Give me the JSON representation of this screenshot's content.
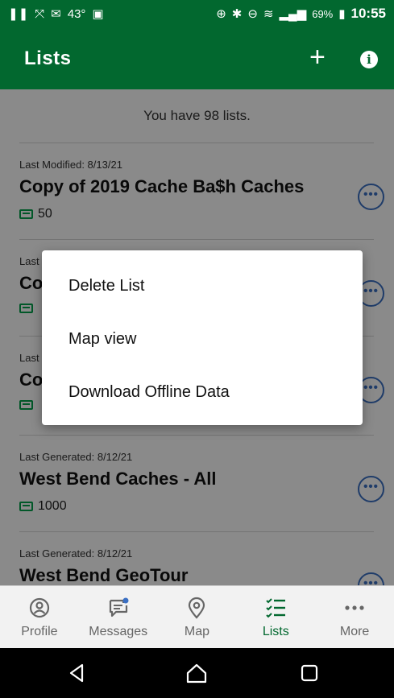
{
  "status_bar": {
    "temperature": "43°",
    "battery": "69%",
    "time": "10:55"
  },
  "app_bar": {
    "title": "Lists",
    "add_icon": "plus-icon",
    "info_icon": "info-icon"
  },
  "summary": "You have 98 lists.",
  "lists": [
    {
      "meta": "Last Modified: 8/13/21",
      "name": "Copy of 2019 Cache Ba$h Caches",
      "count": "50"
    },
    {
      "meta": "Last",
      "name": "Co",
      "count": ""
    },
    {
      "meta": "Last",
      "name": "Co",
      "count": ""
    },
    {
      "meta": "Last Generated: 8/12/21",
      "name": "West Bend Caches - All",
      "count": "1000"
    },
    {
      "meta": "Last Generated: 8/12/21",
      "name": "West Bend GeoTour",
      "count": ""
    }
  ],
  "context_menu": {
    "items": [
      "Delete List",
      "Map view",
      "Download Offline Data"
    ]
  },
  "tab_bar": {
    "tabs": [
      {
        "label": "Profile",
        "icon": "profile-icon"
      },
      {
        "label": "Messages",
        "icon": "messages-icon"
      },
      {
        "label": "Map",
        "icon": "map-pin-icon"
      },
      {
        "label": "Lists",
        "icon": "lists-icon",
        "active": true
      },
      {
        "label": "More",
        "icon": "more-icon"
      }
    ]
  },
  "colors": {
    "brand_green": "#02682f",
    "accent_blue": "#3a6fc3",
    "cache_green": "#02a14a"
  }
}
